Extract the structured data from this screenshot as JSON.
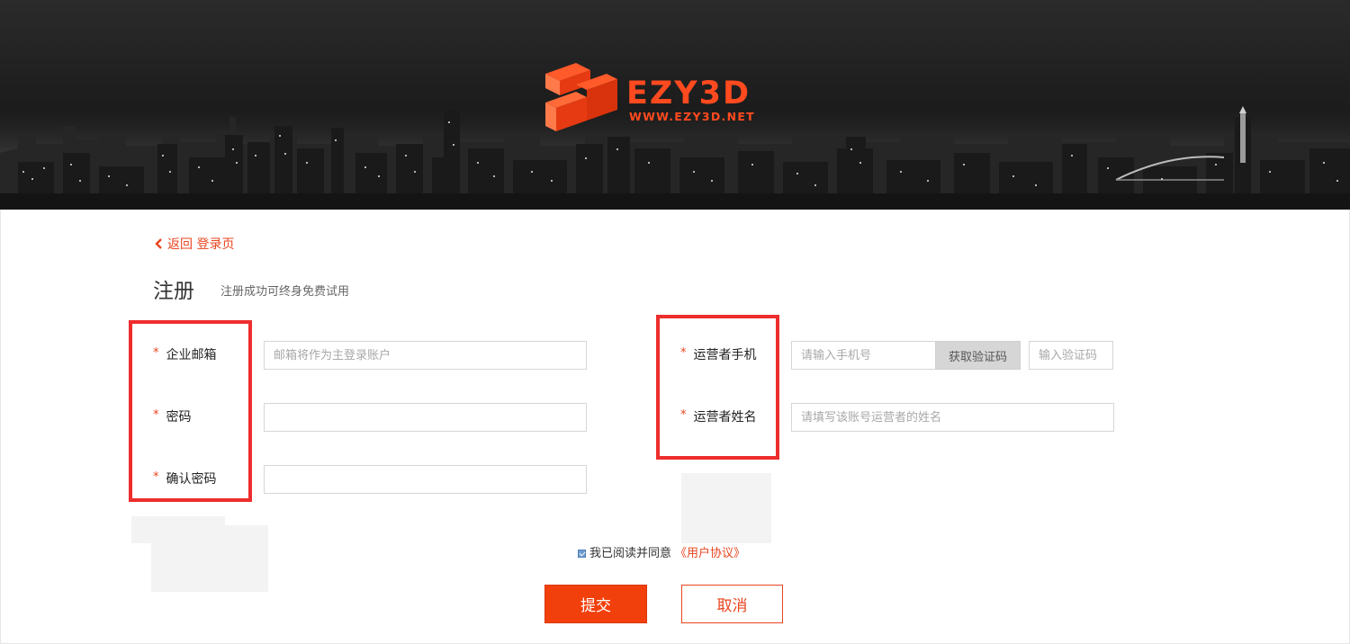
{
  "brand": {
    "name": "EZY3D",
    "url_text": "WWW.EZY3D.NET",
    "accent_color": "#ff4a1f"
  },
  "nav": {
    "back_label": "返回 登录页",
    "back_icon": "chevron-left-icon"
  },
  "header": {
    "title": "注册",
    "subtitle": "注册成功可终身免费试用"
  },
  "form": {
    "required_mark": "*",
    "left_fields": [
      {
        "label": "企业邮箱",
        "value": "",
        "placeholder": "邮箱将作为主登录账户"
      },
      {
        "label": "密码",
        "value": "",
        "placeholder": ""
      },
      {
        "label": "确认密码",
        "value": "",
        "placeholder": ""
      }
    ],
    "right_fields": [
      {
        "label": "运营者手机",
        "value": "",
        "placeholder": "请输入手机号"
      },
      {
        "label": "运营者姓名",
        "value": "",
        "placeholder": "请填写该账号运营者的姓名"
      }
    ],
    "get_code_label": "获取验证码",
    "code_placeholder": "输入验证码"
  },
  "agreement": {
    "checked": true,
    "text": "我已阅读并同意",
    "link_text": "《用户协议》"
  },
  "actions": {
    "submit_label": "提交",
    "cancel_label": "取消"
  },
  "colors": {
    "primary": "#f2400d",
    "highlight": "#ee2d2d"
  }
}
